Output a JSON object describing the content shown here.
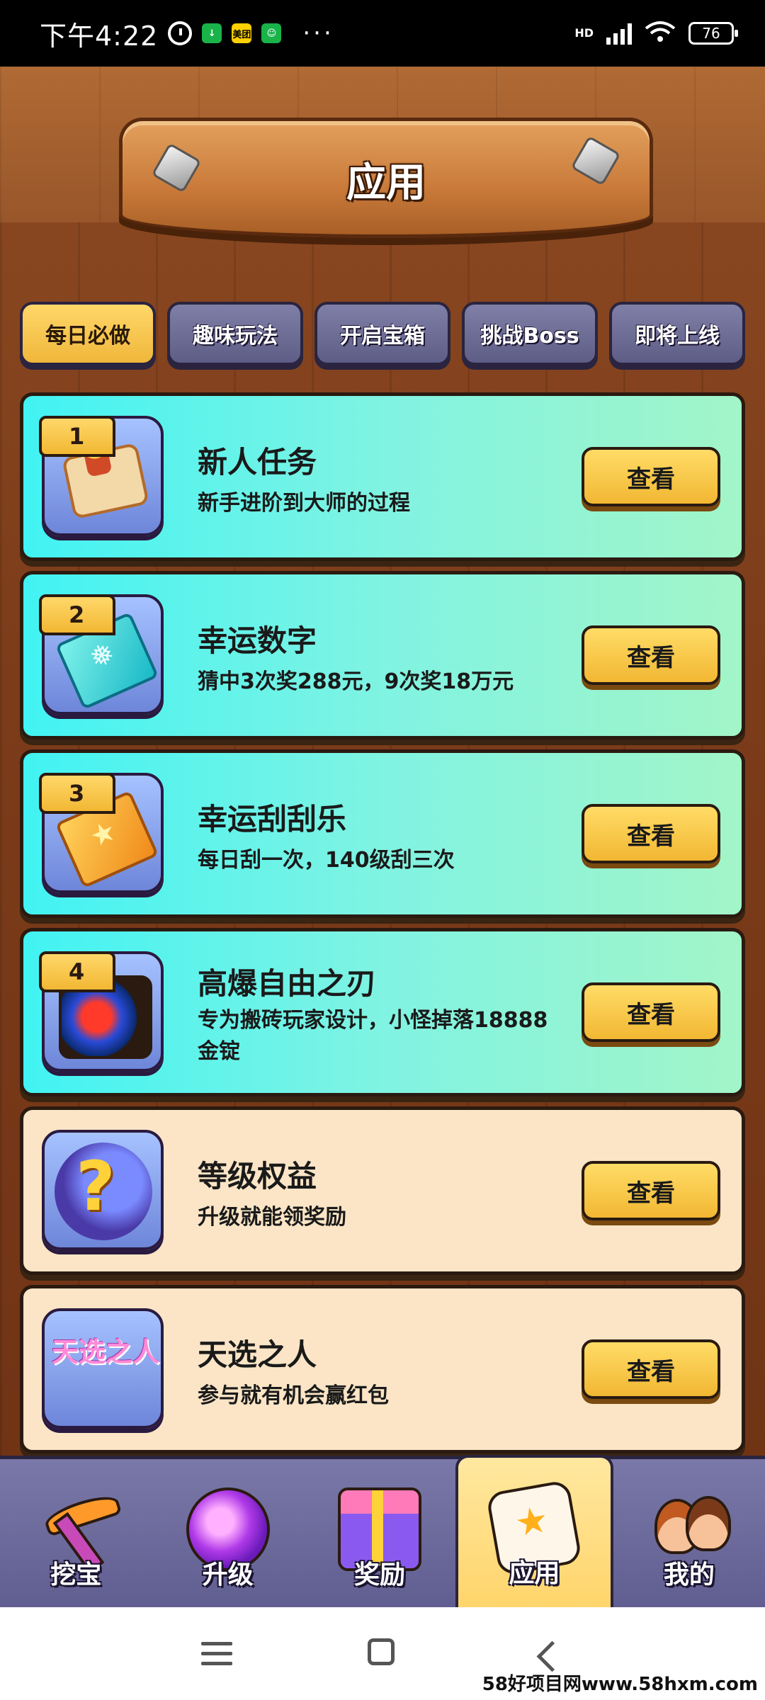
{
  "status_bar": {
    "time": "下午4:22",
    "app_badges": [
      "↓",
      "美团",
      "☺"
    ],
    "more": "···",
    "network": "HD",
    "battery": "76"
  },
  "header": {
    "title": "应用"
  },
  "tabs": [
    {
      "label": "每日必做",
      "active": true
    },
    {
      "label": "趣味玩法",
      "active": false
    },
    {
      "label": "开启宝箱",
      "active": false
    },
    {
      "label": "挑战Boss",
      "active": false
    },
    {
      "label": "即将上线",
      "active": false
    }
  ],
  "cards": [
    {
      "rank": "1",
      "title": "新人任务",
      "desc": "新手进阶到大师的过程",
      "button": "查看",
      "icon": "scroll-icon"
    },
    {
      "rank": "2",
      "title": "幸运数字",
      "desc": "猜中3次奖288元，9次奖18万元",
      "button": "查看",
      "icon": "ticket-icon"
    },
    {
      "rank": "3",
      "title": "幸运刮刮乐",
      "desc": "每日刮一次，140级刮三次",
      "button": "查看",
      "icon": "scratch-ticket-icon"
    },
    {
      "rank": "4",
      "title": "高爆自由之刃",
      "desc": "专为搬砖玩家设计，小怪掉落18888金锭",
      "button": "查看",
      "icon": "game-orb-icon"
    },
    {
      "title": "等级权益",
      "desc": "升级就能领奖励",
      "button": "查看",
      "icon": "wizard-hat-icon"
    },
    {
      "title": "天选之人",
      "desc": "参与就有机会赢红包",
      "button": "查看",
      "icon": "tianxuan-icon",
      "icon_text": "天选之人"
    }
  ],
  "bottom_nav": [
    {
      "label": "挖宝",
      "icon": "pickaxe-icon",
      "active": false
    },
    {
      "label": "升级",
      "icon": "gem-icon",
      "active": false
    },
    {
      "label": "奖励",
      "icon": "gift-icon",
      "active": false
    },
    {
      "label": "应用",
      "icon": "dice-icon",
      "active": true
    },
    {
      "label": "我的",
      "icon": "people-icon",
      "active": false
    }
  ],
  "watermark": "58好项目网www.58hxm.com"
}
